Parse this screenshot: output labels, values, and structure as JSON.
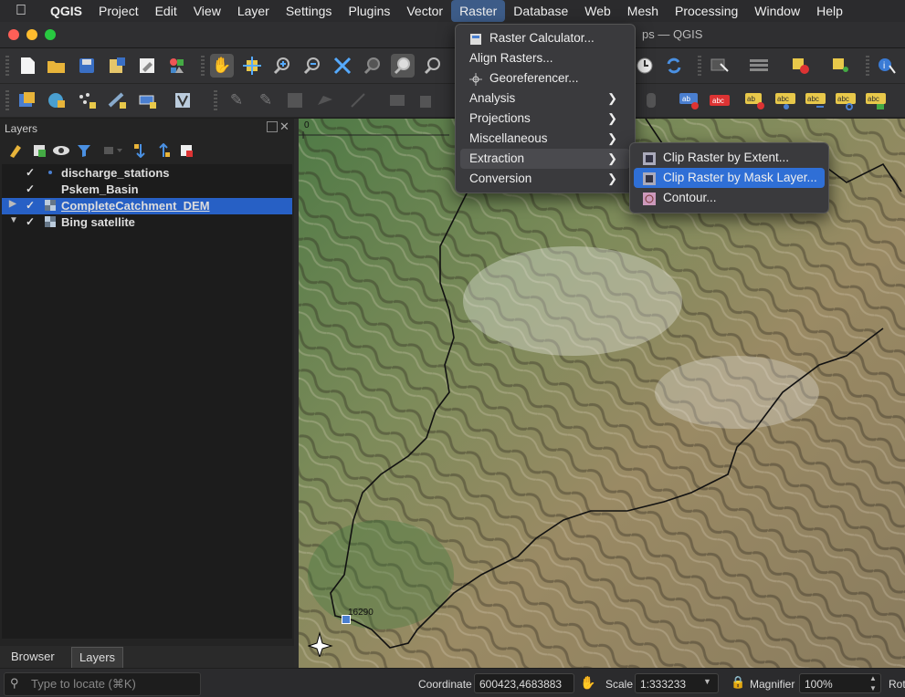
{
  "menubar": {
    "items": [
      "QGIS",
      "Project",
      "Edit",
      "View",
      "Layer",
      "Settings",
      "Plugins",
      "Vector",
      "Raster",
      "Database",
      "Web",
      "Mesh",
      "Processing",
      "Window",
      "Help"
    ],
    "active": "Raster"
  },
  "window": {
    "title_suffix": "ps — QGIS"
  },
  "layers_panel": {
    "title": "Layers",
    "layers": [
      {
        "name": "discharge_stations",
        "checked": true,
        "selected": false
      },
      {
        "name": "Pskem_Basin",
        "checked": true,
        "selected": false
      },
      {
        "name": "CompleteCatchment_DEM",
        "checked": true,
        "selected": true
      },
      {
        "name": "Bing satellite",
        "checked": true,
        "selected": false
      }
    ],
    "tabs": [
      "Browser",
      "Layers"
    ],
    "active_tab": "Layers"
  },
  "locator": {
    "placeholder": "Type to locate (⌘K)"
  },
  "raster_menu": {
    "items": [
      {
        "label": "Raster Calculator...",
        "icon": "calculator-icon",
        "submenu": false
      },
      {
        "label": "Align Rasters...",
        "icon": "",
        "submenu": false
      },
      {
        "label": "Georeferencer...",
        "icon": "georeferencer-icon",
        "submenu": false
      },
      {
        "label": "Analysis",
        "submenu": true
      },
      {
        "label": "Projections",
        "submenu": true
      },
      {
        "label": "Miscellaneous",
        "submenu": true
      },
      {
        "label": "Extraction",
        "submenu": true,
        "highlighted": true
      },
      {
        "label": "Conversion",
        "submenu": true
      }
    ]
  },
  "extraction_submenu": {
    "items": [
      {
        "label": "Clip Raster by Extent...",
        "icon": "clip-extent-icon"
      },
      {
        "label": "Clip Raster by Mask Layer...",
        "icon": "clip-mask-icon",
        "highlighted": true
      },
      {
        "label": "Contour...",
        "icon": "contour-icon"
      }
    ]
  },
  "map": {
    "station_label": "16290",
    "ruler_label": "0"
  },
  "statusbar": {
    "coordinate_label": "Coordinate",
    "coordinate_value": "600423,4683883",
    "scale_label": "Scale",
    "scale_value": "1:333233",
    "magnifier_label": "Magnifier",
    "magnifier_value": "100%",
    "rotation_label": "Rot"
  },
  "colors": {
    "accent": "#2f6fd6",
    "selection": "#2760c5",
    "menu_bg": "#3a3a3d"
  }
}
